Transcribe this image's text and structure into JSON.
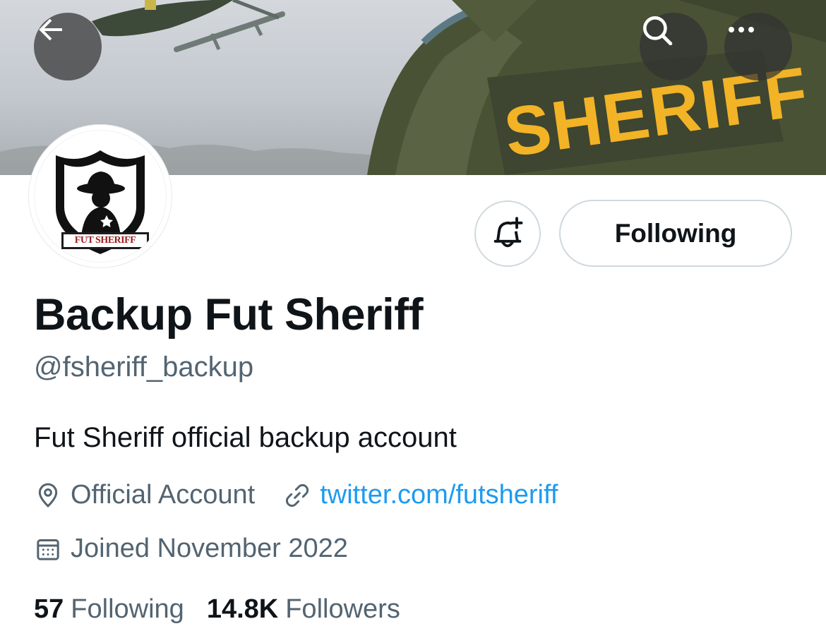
{
  "profile": {
    "display_name": "Backup Fut Sheriff",
    "handle": "@fsheriff_backup",
    "bio": "Fut Sheriff official backup account",
    "location": "Official Account",
    "website": "twitter.com/futsheriff",
    "joined": "Joined November 2022"
  },
  "banner": {
    "patch_text": "SHERIFF"
  },
  "avatar": {
    "label": "FUT SHERIFF"
  },
  "actions": {
    "follow_state_label": "Following",
    "notify_icon": "bell-plus-icon"
  },
  "header_icons": {
    "back": "arrow-left-icon",
    "search": "search-icon",
    "more": "more-horizontal-icon"
  },
  "stats": {
    "following_count": "57",
    "following_label": "Following",
    "followers_count": "14.8K",
    "followers_label": "Followers"
  },
  "colors": {
    "link": "#1d9bf0",
    "secondary_text": "#536471",
    "primary_text": "#0f1419",
    "border": "#cfd9de",
    "patch_yellow": "#f2b326",
    "jacket_green": "#4a5236"
  }
}
